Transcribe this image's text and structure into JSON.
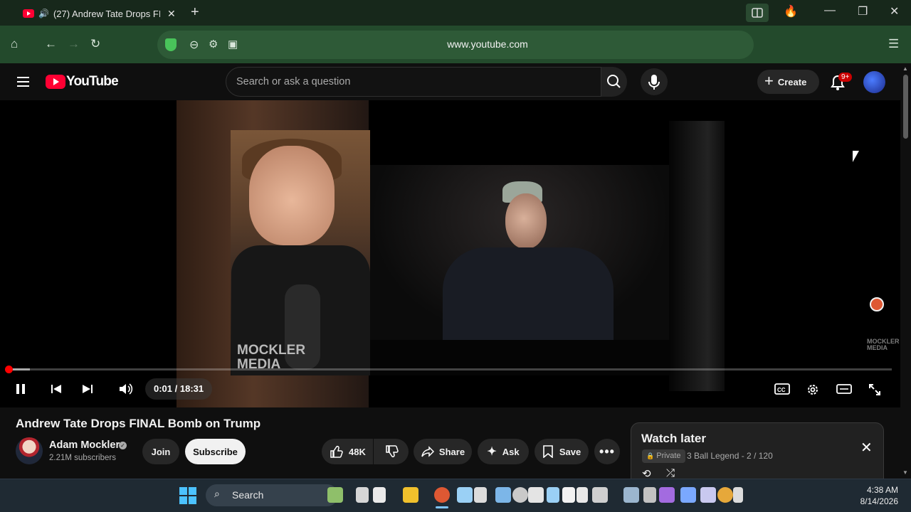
{
  "browser": {
    "tab_title": "(27) Andrew Tate Drops FI",
    "tab_speaker": "🔊",
    "url": "www.youtube.com"
  },
  "youtube": {
    "logo_text": "YouTube",
    "search_placeholder": "Search or ask a question",
    "create_label": "Create",
    "notification_badge": "9+"
  },
  "video": {
    "watermark_left": "MOCKLER MEDIA",
    "watermark_right": "MOCKLER MEDIA",
    "time": "0:01 / 18:31",
    "progress_fraction": 0.001
  },
  "meta": {
    "title": "Andrew Tate Drops FINAL Bomb on Trump",
    "channel": "Adam Mockler",
    "subscribers": "2.21M subscribers",
    "join_label": "Join",
    "subscribe_label": "Subscribe",
    "likes": "48K",
    "share_label": "Share",
    "ask_label": "Ask",
    "save_label": "Save"
  },
  "watch_later": {
    "title": "Watch later",
    "privacy": "Private",
    "subtitle": "3 Ball Legend - 2 / 120"
  },
  "taskbar": {
    "search_label": "Search",
    "time": "4:38 AM",
    "date": "8/14/2026"
  }
}
